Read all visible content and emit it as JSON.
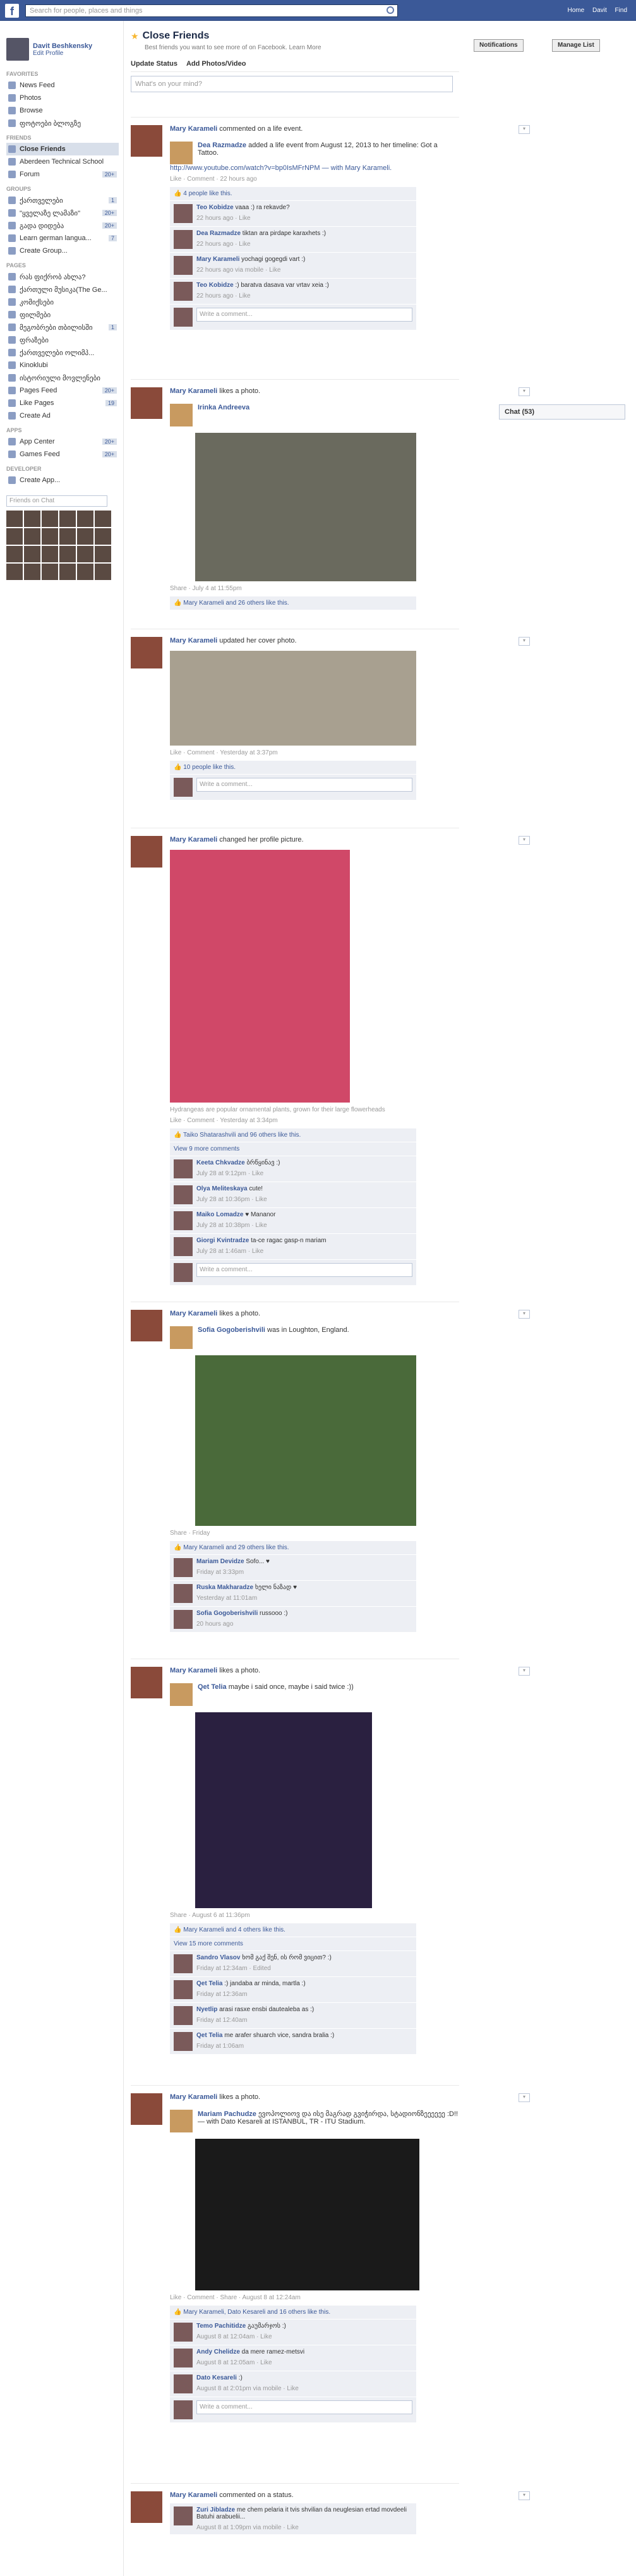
{
  "topbar": {
    "search_placeholder": "Search for people, places and things",
    "links": [
      "Home",
      "Davit",
      "Find"
    ]
  },
  "user": {
    "name": "Davit Beshkensky",
    "edit": "Edit Profile"
  },
  "sidebar": {
    "favorites_title": "FAVORITES",
    "favorites": [
      {
        "label": "News Feed"
      },
      {
        "label": "Photos"
      },
      {
        "label": "Browse"
      },
      {
        "label": "ფოტოები ბლოგზე"
      }
    ],
    "friends_title": "FRIENDS",
    "friends": [
      {
        "label": "Close Friends",
        "active": true
      },
      {
        "label": "Aberdeen Technical School"
      },
      {
        "label": "Forum",
        "count": "20+"
      }
    ],
    "groups_title": "GROUPS",
    "groups": [
      {
        "label": "ქართველები",
        "count": "1"
      },
      {
        "label": "\"ყველაზე ლამაზი\"",
        "count": "20+"
      },
      {
        "label": "გადა დიდება",
        "count": "20+"
      },
      {
        "label": "Learn german langua...",
        "count": "7"
      },
      {
        "label": "Create Group..."
      }
    ],
    "pages_title": "PAGES",
    "pages": [
      {
        "label": "რას ფიქრობ ახლა?"
      },
      {
        "label": "ქართული მუსიკა(The Ge..."
      },
      {
        "label": "კომიქსები"
      },
      {
        "label": "ფილმები"
      },
      {
        "label": "მეგობრები თბილისში",
        "count": "1"
      },
      {
        "label": "ფრაზები"
      },
      {
        "label": "ქართველები ოლიმპ..."
      },
      {
        "label": "Kinoklubi"
      },
      {
        "label": "ისტორიული მოვლენები"
      },
      {
        "label": "Pages Feed",
        "count": "20+"
      },
      {
        "label": "Like Pages",
        "count": "19"
      },
      {
        "label": "Create Ad"
      }
    ],
    "apps_title": "APPS",
    "apps": [
      {
        "label": "App Center",
        "count": "20+"
      },
      {
        "label": "Games Feed",
        "count": "20+"
      }
    ],
    "dev_title": "DEVELOPER",
    "dev": [
      {
        "label": "Create App..."
      }
    ],
    "chat_placeholder": "Friends on Chat"
  },
  "main": {
    "title": "Close Friends",
    "subtitle": "Best friends you want to see more of on Facebook. Learn More",
    "notifications_btn": "Notifications",
    "manage_btn": "Manage List",
    "tab_status": "Update Status",
    "tab_photo": "Add Photos/Video",
    "composer_placeholder": "What's on your mind?"
  },
  "stories": [
    {
      "actor": "Mary Karameli",
      "action": "commented on a life event.",
      "sub_actor": "Dea Razmadze",
      "sub_text": "added a life event from August 12, 2013 to her timeline: Got a Tattoo.",
      "link": "http://www.youtube.com/watch?v=bp0IsMFrNPM — with Mary Karameli.",
      "meta": "Like · Comment · 22 hours ago",
      "likes": "4 people like this.",
      "comments": [
        {
          "name": "Teo Kobidze",
          "text": "vaaa :) ra rekavde?",
          "time": "22 hours ago · Like"
        },
        {
          "name": "Dea Razmadze",
          "text": "tiktan ara pirdape karaxhets :)",
          "time": "22 hours ago · Like"
        },
        {
          "name": "Mary Karameli",
          "text": "yochagi gogegdi vart :)",
          "time": "22 hours ago via mobile · Like"
        },
        {
          "name": "Teo Kobidze",
          "text": ":) baratva dasava var vrtav xeia :)",
          "time": "22 hours ago · Like"
        }
      ],
      "write": "Write a comment..."
    },
    {
      "actor": "Mary Karameli",
      "action": "likes a photo.",
      "sub_actor": "Irinka Andreeva",
      "meta": "Share · July 4 at 11:55pm",
      "likes": "Mary Karameli and 26 others like this."
    },
    {
      "actor": "Mary Karameli",
      "action": "updated her cover photo.",
      "meta": "Like · Comment · Yesterday at 3:37pm",
      "likes": "10 people like this.",
      "write": "Write a comment..."
    },
    {
      "actor": "Mary Karameli",
      "action": "changed her profile picture.",
      "caption": "Hydrangeas are popular ornamental plants, grown for their large flowerheads",
      "meta": "Like · Comment · Yesterday at 3:34pm",
      "likes": "Taiko Shatarashvili and 96 others like this.",
      "more": "View 9 more comments",
      "comments": [
        {
          "name": "Keeta Chkvadze",
          "text": "ბრწყინავ :)",
          "time": "July 28 at 9:12pm · Like"
        },
        {
          "name": "Olya Meliteskaya",
          "text": "cute!",
          "time": "July 28 at 10:36pm · Like"
        },
        {
          "name": "Maiko Lomadze",
          "text": "♥ Mananor",
          "time": "July 28 at 10:38pm · Like"
        },
        {
          "name": "Giorgi Kvintradze",
          "text": "ta-ce ragac gasp-n mariam",
          "time": "July 28 at 1:46am · Like"
        }
      ],
      "write": "Write a comment..."
    },
    {
      "actor": "Mary Karameli",
      "action": "likes a photo.",
      "sub_actor": "Sofia Gogoberishvili",
      "sub_text": "was in Loughton, England.",
      "meta": "Share · Friday",
      "likes": "Mary Karameli and 29 others like this.",
      "comments": [
        {
          "name": "Mariam Devidze",
          "text": "Sofo... ♥",
          "time": "Friday at 3:33pm"
        },
        {
          "name": "Ruska Makharadze",
          "text": "ხელი ნაზად ♥",
          "time": "Yesterday at 11:01am"
        },
        {
          "name": "Sofia Gogoberishvili",
          "text": "russooo :)",
          "time": "20 hours ago"
        }
      ]
    },
    {
      "actor": "Mary Karameli",
      "action": "likes a photo.",
      "sub_actor": "Qet Telia",
      "sub_text": "maybe i said once, maybe i said twice :))",
      "meta": "Share · August 6 at 11:36pm",
      "likes": "Mary Karameli and 4 others like this.",
      "more": "View 15 more comments",
      "comments": [
        {
          "name": "Sandro Vlasov",
          "text": "ხომ გაქ შენ, ის რომ ვიცით? :)",
          "time": "Friday at 12:34am · Edited"
        },
        {
          "name": "Qet Telia",
          "text": ":) jandaba ar minda, martla :)",
          "time": "Friday at 12:36am"
        },
        {
          "name": "Nyetlip",
          "text": "arasi rasxe ensbi dautealeba as :)",
          "time": "Friday at 12:40am"
        },
        {
          "name": "Qet Telia",
          "text": "me arafer shuarch vice, sandra bralia :)",
          "time": "Friday at 1:06am"
        }
      ]
    },
    {
      "actor": "Mary Karameli",
      "action": "likes a photo.",
      "sub_actor": "Mariam Pachudze",
      "sub_text": "ევოპოლიოვ და ისე მაგრად გვიჭირდა, სტადიონზეეეეეე :D!! — with Dato Kesareli at ISTANBUL, TR - ITU Stadium.",
      "meta": "Like · Comment · Share · August 8 at 12:24am",
      "likes": "Mary Karameli, Dato Kesareli and 16 others like this.",
      "comments": [
        {
          "name": "Temo Pachitidze",
          "text": "გაუმარჯოს :)",
          "time": "August 8 at 12:04am · Like"
        },
        {
          "name": "Andy Chelidze",
          "text": "da mere ramez-metsvi",
          "time": "August 8 at 12:05am · Like"
        },
        {
          "name": "Dato Kesareli",
          "text": ":)",
          "time": "August 8 at 2:01pm via mobile · Like"
        }
      ],
      "write": "Write a comment..."
    },
    {
      "actor": "Mary Karameli",
      "action": "commented on a status.",
      "comments": [
        {
          "name": "Zuri Jibladze",
          "text": "me chem pelaria it tvis shvilian da neuglesian ertad movdeeli Batuhi arabuelii...",
          "time": "August 8 at 1:09pm via mobile · Like"
        }
      ]
    }
  ],
  "chat_bar": "Chat (53)"
}
